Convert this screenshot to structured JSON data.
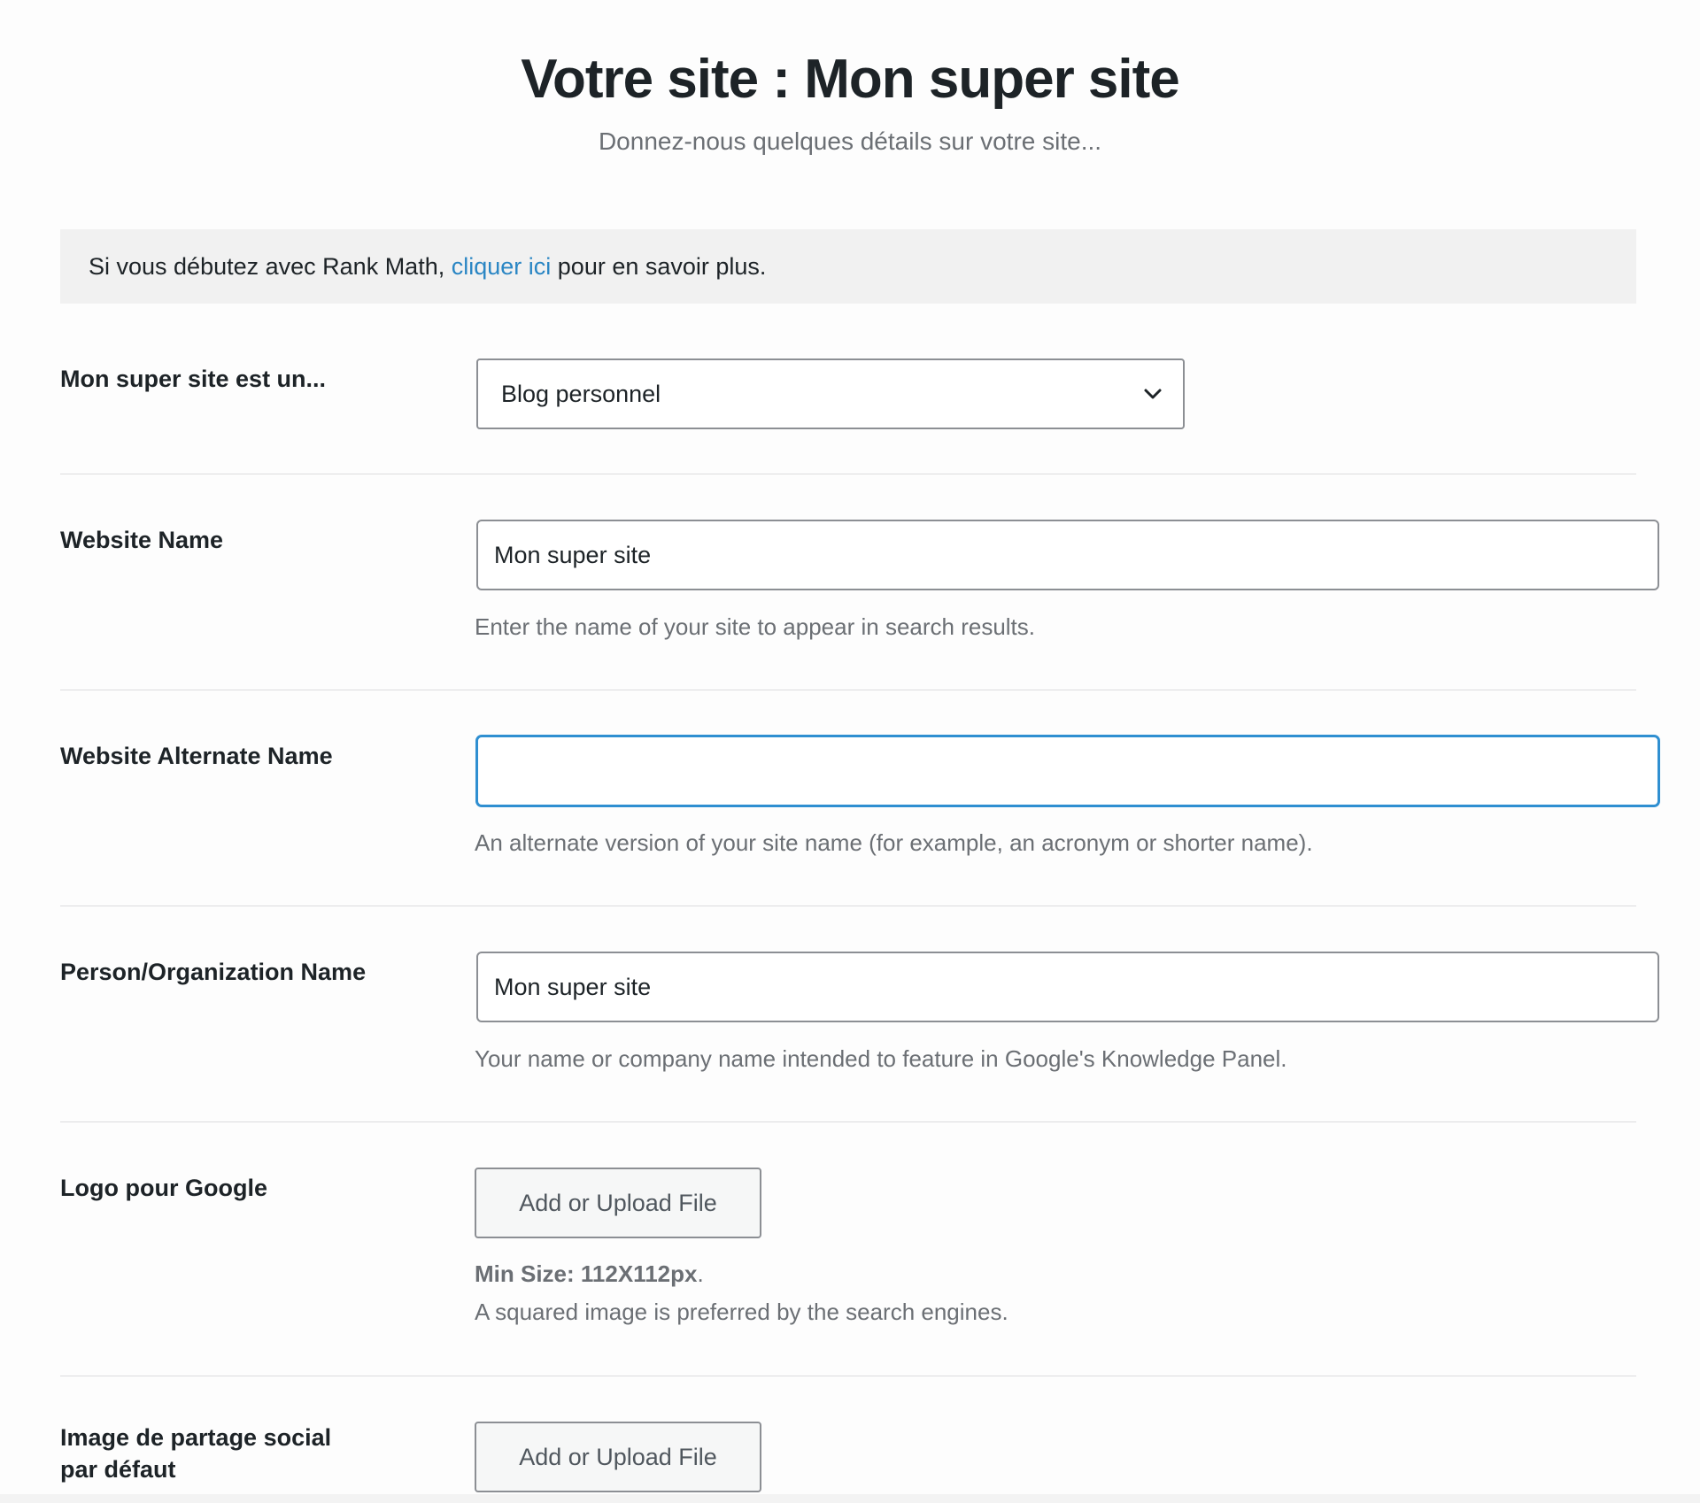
{
  "header": {
    "title": "Votre site : Mon super site",
    "subtitle": "Donnez-nous quelques détails sur votre site..."
  },
  "notice": {
    "text_before": "Si vous débutez avec Rank Math, ",
    "link_text": "cliquer ici",
    "text_after": " pour en savoir plus.",
    "link_color": "#2a86c4"
  },
  "site_type": {
    "label": "Mon super site est un...",
    "selected": "Blog personnel",
    "icon": "chevron-down-icon"
  },
  "website_name": {
    "label": "Website Name",
    "value": "Mon super site",
    "description": "Enter the name of your site to appear in search results."
  },
  "website_alternate_name": {
    "label": "Website Alternate Name",
    "value": "",
    "description": "An alternate version of your site name (for example, an acronym or shorter name)."
  },
  "person_org_name": {
    "label": "Person/Organization Name",
    "value": "Mon super site",
    "description": "Your name or company name intended to feature in Google's Knowledge Panel."
  },
  "logo": {
    "label": "Logo pour Google",
    "button_label": "Add or Upload File",
    "min_size": "Min Size: 112X112px",
    "min_size_suffix": ".",
    "description": "A squared image is preferred by the search engines."
  },
  "social_image": {
    "label_line1": "Image de partage social",
    "label_line2": "par défaut",
    "button_label": "Add or Upload File"
  }
}
